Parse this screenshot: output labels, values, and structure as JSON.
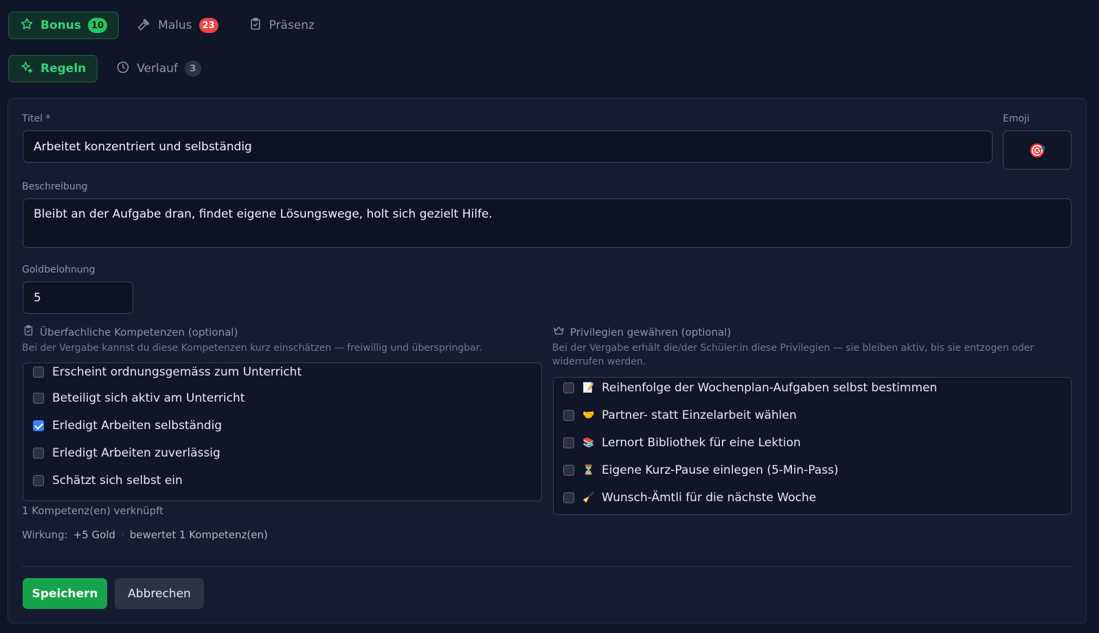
{
  "tabs_top": [
    {
      "label": "Bonus",
      "badge": "10",
      "icon": "star-icon"
    },
    {
      "label": "Malus",
      "badge": "23",
      "icon": "hammer-icon"
    },
    {
      "label": "Präsenz",
      "icon": "clipboard-check-icon"
    }
  ],
  "tabs_sub": [
    {
      "label": "Regeln",
      "icon": "sparkles-icon"
    },
    {
      "label": "Verlauf",
      "badge": "3",
      "icon": "clock-icon"
    }
  ],
  "form": {
    "title_label": "Titel *",
    "title_value": "Arbeitet konzentriert und selbständig",
    "emoji_label": "Emoji",
    "emoji_value": "🎯",
    "description_label": "Beschreibung",
    "description_value": "Bleibt an der Aufgabe dran, findet eigene Lösungswege, holt sich gezielt Hilfe.",
    "gold_label": "Goldbelohnung",
    "gold_value": "5"
  },
  "competencies": {
    "heading": "Überfachliche Kompetenzen (optional)",
    "description": "Bei der Vergabe kannst du diese Kompetenzen kurz einschätzen — freiwillig und überspringbar.",
    "items": [
      {
        "label": "Erscheint ordnungsgemäss zum Unterricht",
        "checked": false
      },
      {
        "label": "Beteiligt sich aktiv am Unterricht",
        "checked": false
      },
      {
        "label": "Erledigt Arbeiten selbständig",
        "checked": true
      },
      {
        "label": "Erledigt Arbeiten zuverlässig",
        "checked": false
      },
      {
        "label": "Schätzt sich selbst ein",
        "checked": false
      }
    ],
    "linked_count": "1 Kompetenz(en) verknüpft"
  },
  "privileges": {
    "heading": "Privilegien gewähren (optional)",
    "description": "Bei der Vergabe erhält die/der Schüler:in diese Privilegien — sie bleiben aktiv, bis sie entzogen oder widerrufen werden.",
    "items": [
      {
        "emoji": "📝",
        "label": "Reihenfolge der Wochenplan-Aufgaben selbst bestimmen",
        "checked": false
      },
      {
        "emoji": "🤝",
        "label": "Partner- statt Einzelarbeit wählen",
        "checked": false
      },
      {
        "emoji": "📚",
        "label": "Lernort Bibliothek für eine Lektion",
        "checked": false
      },
      {
        "emoji": "⏳",
        "label": "Eigene Kurz-Pause einlegen (5-Min-Pass)",
        "checked": false
      },
      {
        "emoji": "🧹",
        "label": "Wunsch-Ämtli für die nächste Woche",
        "checked": false
      }
    ]
  },
  "effect": {
    "label": "Wirkung:",
    "gold": "+5 Gold",
    "separator": "·",
    "rated": "bewertet 1 Kompetenz(en)"
  },
  "buttons": {
    "save": "Speichern",
    "cancel": "Abbrechen"
  },
  "colors": {
    "accent_green": "#22c55e",
    "badge_red": "#ef4444",
    "checkbox_blue": "#3b82f6",
    "background": "#0f1628"
  }
}
